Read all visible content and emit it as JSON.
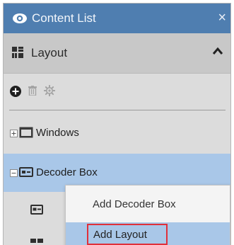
{
  "panel": {
    "title": "Content List",
    "close_glyph": "×",
    "title_icon": "eye-icon"
  },
  "section": {
    "label": "Layout",
    "icon": "layout-grid-icon",
    "toggle_icon": "chevron-up-icon"
  },
  "toolbar": {
    "icons": [
      "add-circle-icon",
      "trash-icon",
      "gear-icon"
    ]
  },
  "tree": {
    "items": [
      {
        "label": "Windows",
        "expander": "+",
        "icon": "window-icon",
        "selected": false
      },
      {
        "label": "Decoder Box",
        "expander": "−",
        "icon": "decoder-box-icon",
        "selected": true
      }
    ]
  },
  "context_menu": {
    "items": [
      {
        "label": "Add Decoder Box",
        "highlighted": false
      },
      {
        "label": "Add Layout",
        "highlighted": true
      }
    ]
  },
  "colors": {
    "titlebar": "#4f7eb0",
    "panel_bg": "#dcdcdc",
    "section_bg": "#c8c8c8",
    "selection": "#a9c7e8",
    "callout": "#e0303a"
  }
}
